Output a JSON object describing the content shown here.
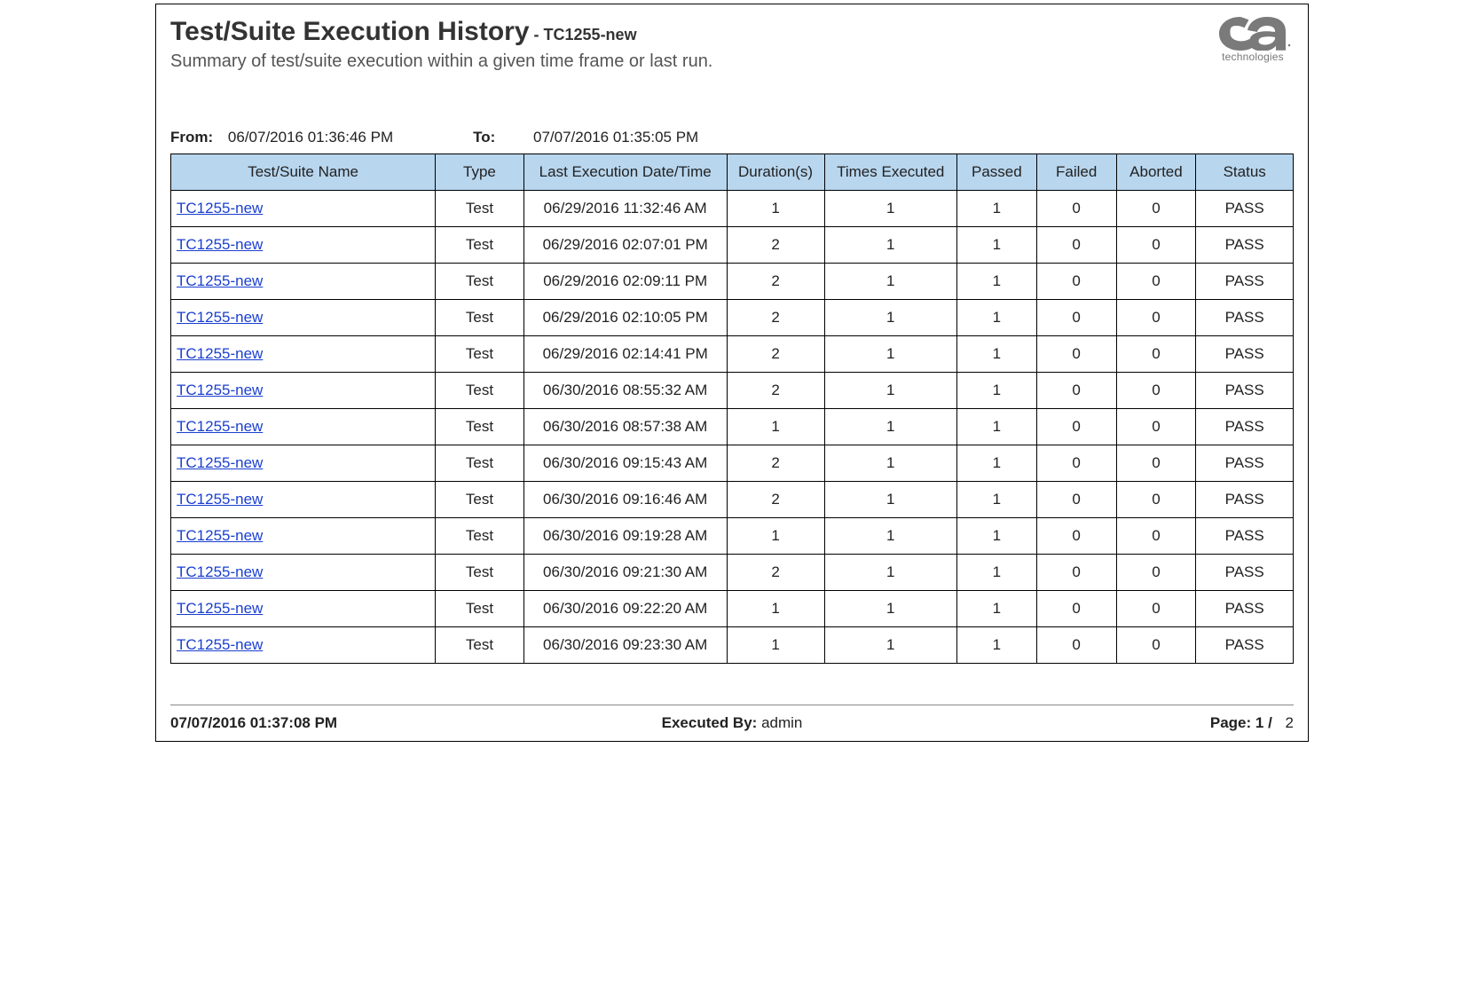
{
  "header": {
    "title": "Test/Suite Execution History",
    "title_suffix": " - TC1255-new",
    "subtitle": "Summary of test/suite execution within a given time frame or last run.",
    "logo_sub": "technologies"
  },
  "range": {
    "from_label": "From:",
    "from_value": "06/07/2016 01:36:46 PM",
    "to_label": "To:",
    "to_value": "07/07/2016 01:35:05 PM"
  },
  "columns": {
    "name": "Test/Suite Name",
    "type": "Type",
    "ldt": "Last Execution Date/Time",
    "dur": "Duration(s)",
    "times": "Times Executed",
    "passed": "Passed",
    "failed": "Failed",
    "aborted": "Aborted",
    "status": "Status"
  },
  "rows": [
    {
      "name": "TC1255-new",
      "type": "Test",
      "ldt": "06/29/2016 11:32:46 AM",
      "dur": "1",
      "times": "1",
      "passed": "1",
      "failed": "0",
      "aborted": "0",
      "status": "PASS"
    },
    {
      "name": "TC1255-new",
      "type": "Test",
      "ldt": "06/29/2016 02:07:01 PM",
      "dur": "2",
      "times": "1",
      "passed": "1",
      "failed": "0",
      "aborted": "0",
      "status": "PASS"
    },
    {
      "name": "TC1255-new",
      "type": "Test",
      "ldt": "06/29/2016 02:09:11 PM",
      "dur": "2",
      "times": "1",
      "passed": "1",
      "failed": "0",
      "aborted": "0",
      "status": "PASS"
    },
    {
      "name": "TC1255-new",
      "type": "Test",
      "ldt": "06/29/2016 02:10:05 PM",
      "dur": "2",
      "times": "1",
      "passed": "1",
      "failed": "0",
      "aborted": "0",
      "status": "PASS"
    },
    {
      "name": "TC1255-new",
      "type": "Test",
      "ldt": "06/29/2016 02:14:41 PM",
      "dur": "2",
      "times": "1",
      "passed": "1",
      "failed": "0",
      "aborted": "0",
      "status": "PASS"
    },
    {
      "name": "TC1255-new",
      "type": "Test",
      "ldt": "06/30/2016 08:55:32 AM",
      "dur": "2",
      "times": "1",
      "passed": "1",
      "failed": "0",
      "aborted": "0",
      "status": "PASS"
    },
    {
      "name": "TC1255-new",
      "type": "Test",
      "ldt": "06/30/2016 08:57:38 AM",
      "dur": "1",
      "times": "1",
      "passed": "1",
      "failed": "0",
      "aborted": "0",
      "status": "PASS"
    },
    {
      "name": "TC1255-new",
      "type": "Test",
      "ldt": "06/30/2016 09:15:43 AM",
      "dur": "2",
      "times": "1",
      "passed": "1",
      "failed": "0",
      "aborted": "0",
      "status": "PASS"
    },
    {
      "name": "TC1255-new",
      "type": "Test",
      "ldt": "06/30/2016 09:16:46 AM",
      "dur": "2",
      "times": "1",
      "passed": "1",
      "failed": "0",
      "aborted": "0",
      "status": "PASS"
    },
    {
      "name": "TC1255-new",
      "type": "Test",
      "ldt": "06/30/2016 09:19:28 AM",
      "dur": "1",
      "times": "1",
      "passed": "1",
      "failed": "0",
      "aborted": "0",
      "status": "PASS"
    },
    {
      "name": "TC1255-new",
      "type": "Test",
      "ldt": "06/30/2016 09:21:30 AM",
      "dur": "2",
      "times": "1",
      "passed": "1",
      "failed": "0",
      "aborted": "0",
      "status": "PASS"
    },
    {
      "name": "TC1255-new",
      "type": "Test",
      "ldt": "06/30/2016 09:22:20 AM",
      "dur": "1",
      "times": "1",
      "passed": "1",
      "failed": "0",
      "aborted": "0",
      "status": "PASS"
    },
    {
      "name": "TC1255-new",
      "type": "Test",
      "ldt": "06/30/2016 09:23:30 AM",
      "dur": "1",
      "times": "1",
      "passed": "1",
      "failed": "0",
      "aborted": "0",
      "status": "PASS"
    }
  ],
  "footer": {
    "timestamp": "07/07/2016 01:37:08 PM",
    "exec_label": "Executed By:",
    "exec_value": "admin",
    "page_label": "Page: 1 /",
    "page_total": "2"
  }
}
